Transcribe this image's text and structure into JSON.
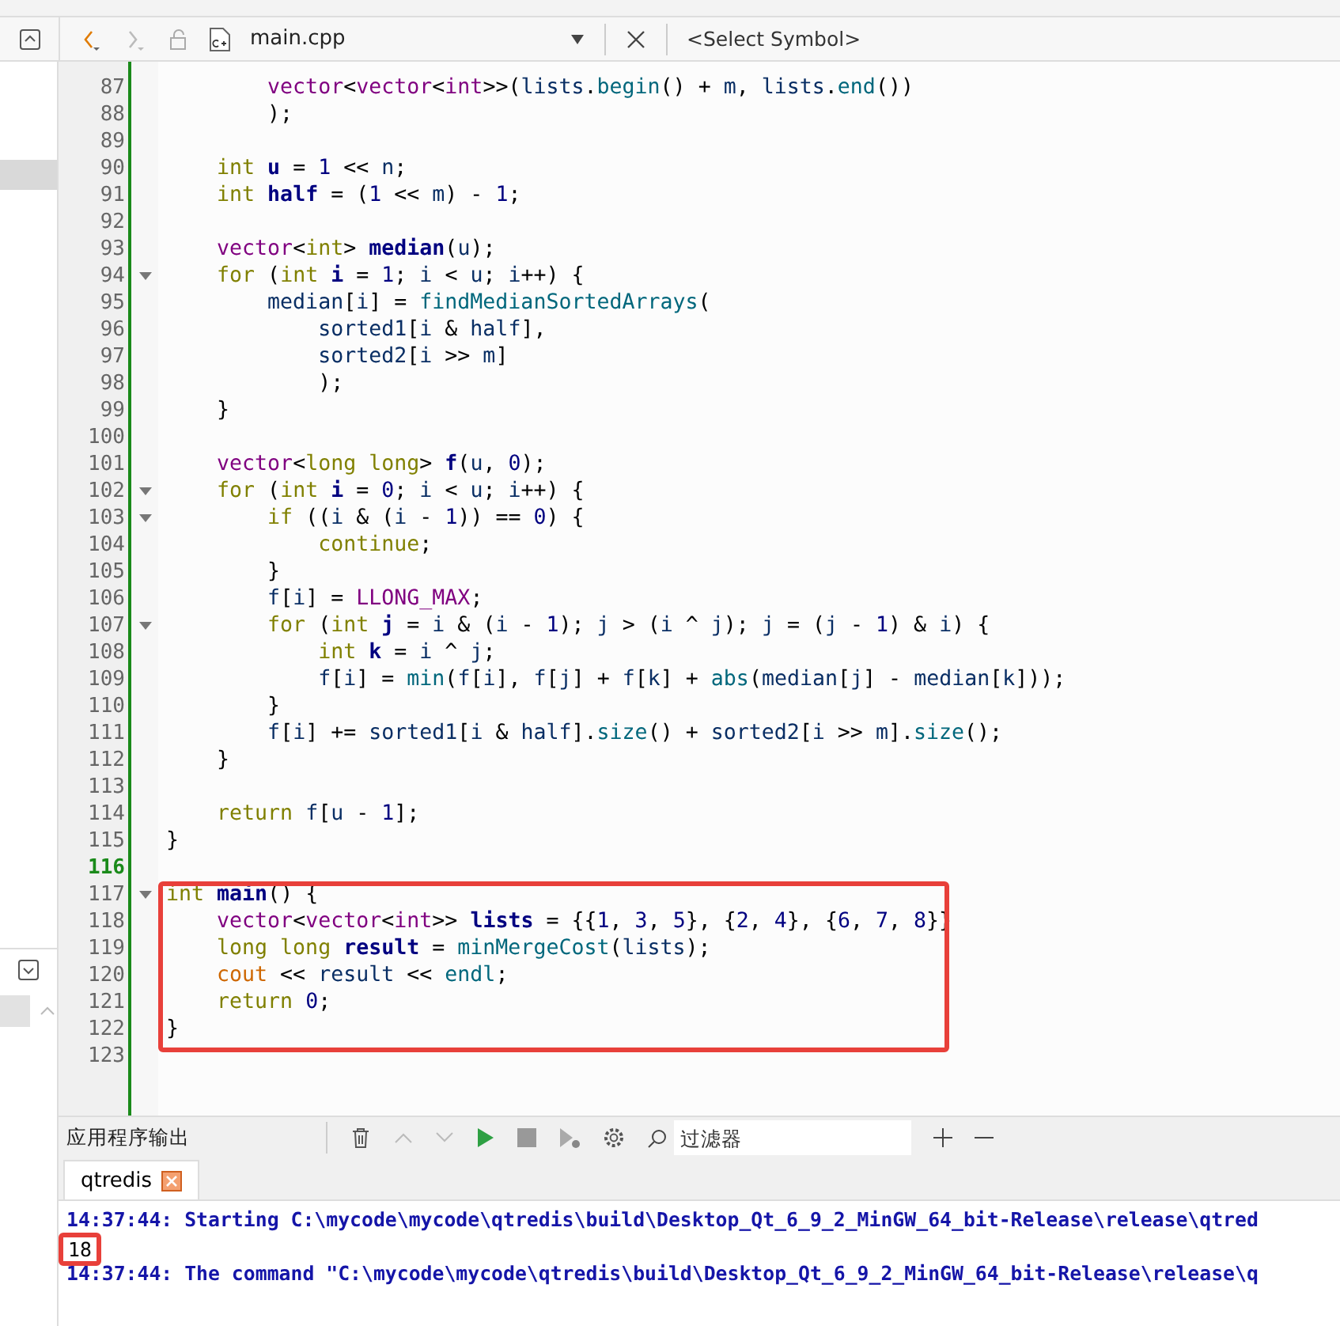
{
  "toolbar": {
    "file_name": "main.cpp",
    "symbol_placeholder": "<Select Symbol>",
    "back_enabled": true,
    "forward_enabled": false
  },
  "editor": {
    "blocks": [
      {
        "framed": false,
        "lines": [
          {
            "number": "87",
            "fold": false,
            "current": false,
            "tokens": [
              {
                "text": "        vector",
                "kind": "type"
              },
              {
                "text": "<",
                "kind": "plain"
              },
              {
                "text": "vector",
                "kind": "type"
              },
              {
                "text": "<",
                "kind": "plain"
              },
              {
                "text": "int",
                "kind": "type"
              },
              {
                "text": ">>(",
                "kind": "plain"
              },
              {
                "text": "lists",
                "kind": "var"
              },
              {
                "text": ".",
                "kind": "plain"
              },
              {
                "text": "begin",
                "kind": "func"
              },
              {
                "text": "() + ",
                "kind": "plain"
              },
              {
                "text": "m",
                "kind": "var"
              },
              {
                "text": ", ",
                "kind": "plain"
              },
              {
                "text": "lists",
                "kind": "var"
              },
              {
                "text": ".",
                "kind": "plain"
              },
              {
                "text": "end",
                "kind": "func"
              },
              {
                "text": "())",
                "kind": "plain"
              }
            ]
          },
          {
            "number": "88",
            "fold": false,
            "current": false,
            "tokens": [
              {
                "text": "        );",
                "kind": "plain"
              }
            ]
          },
          {
            "number": "89",
            "fold": false,
            "current": false
          },
          {
            "number": "90",
            "fold": false,
            "current": false,
            "tokens": [
              {
                "text": "    int",
                "kind": "keyword"
              },
              {
                "text": " u",
                "kind": "decl"
              },
              {
                "text": " = ",
                "kind": "plain"
              },
              {
                "text": "1",
                "kind": "number"
              },
              {
                "text": " << ",
                "kind": "plain"
              },
              {
                "text": "n",
                "kind": "var"
              },
              {
                "text": ";",
                "kind": "plain"
              }
            ]
          },
          {
            "number": "91",
            "fold": false,
            "current": false,
            "tokens": [
              {
                "text": "    int",
                "kind": "keyword"
              },
              {
                "text": " half",
                "kind": "decl"
              },
              {
                "text": " = (",
                "kind": "plain"
              },
              {
                "text": "1",
                "kind": "number"
              },
              {
                "text": " << ",
                "kind": "plain"
              },
              {
                "text": "m",
                "kind": "var"
              },
              {
                "text": ") - ",
                "kind": "plain"
              },
              {
                "text": "1",
                "kind": "number"
              },
              {
                "text": ";",
                "kind": "plain"
              }
            ]
          },
          {
            "number": "92",
            "fold": false,
            "current": false
          },
          {
            "number": "93",
            "fold": false,
            "current": false,
            "tokens": [
              {
                "text": "    vector",
                "kind": "type"
              },
              {
                "text": "<",
                "kind": "plain"
              },
              {
                "text": "int",
                "kind": "keyword"
              },
              {
                "text": "> ",
                "kind": "plain"
              },
              {
                "text": "median",
                "kind": "decl"
              },
              {
                "text": "(",
                "kind": "plain"
              },
              {
                "text": "u",
                "kind": "var"
              },
              {
                "text": ");",
                "kind": "plain"
              }
            ]
          },
          {
            "number": "94",
            "fold": true,
            "current": false,
            "tokens": [
              {
                "text": "    for",
                "kind": "keyword"
              },
              {
                "text": " (",
                "kind": "plain"
              },
              {
                "text": "int",
                "kind": "keyword"
              },
              {
                "text": " i",
                "kind": "decl"
              },
              {
                "text": " = ",
                "kind": "plain"
              },
              {
                "text": "1",
                "kind": "number"
              },
              {
                "text": "; ",
                "kind": "plain"
              },
              {
                "text": "i",
                "kind": "var"
              },
              {
                "text": " < ",
                "kind": "plain"
              },
              {
                "text": "u",
                "kind": "var"
              },
              {
                "text": "; ",
                "kind": "plain"
              },
              {
                "text": "i",
                "kind": "var"
              },
              {
                "text": "++) {",
                "kind": "plain"
              }
            ]
          },
          {
            "number": "95",
            "fold": false,
            "current": false,
            "tokens": [
              {
                "text": "        median",
                "kind": "var"
              },
              {
                "text": "[",
                "kind": "plain"
              },
              {
                "text": "i",
                "kind": "var"
              },
              {
                "text": "] = ",
                "kind": "plain"
              },
              {
                "text": "findMedianSortedArrays",
                "kind": "func"
              },
              {
                "text": "(",
                "kind": "plain"
              }
            ]
          },
          {
            "number": "96",
            "fold": false,
            "current": false,
            "tokens": [
              {
                "text": "            sorted1",
                "kind": "var"
              },
              {
                "text": "[",
                "kind": "plain"
              },
              {
                "text": "i",
                "kind": "var"
              },
              {
                "text": " & ",
                "kind": "plain"
              },
              {
                "text": "half",
                "kind": "var"
              },
              {
                "text": "],",
                "kind": "plain"
              }
            ]
          },
          {
            "number": "97",
            "fold": false,
            "current": false,
            "tokens": [
              {
                "text": "            sorted2",
                "kind": "var"
              },
              {
                "text": "[",
                "kind": "plain"
              },
              {
                "text": "i",
                "kind": "var"
              },
              {
                "text": " >> ",
                "kind": "plain"
              },
              {
                "text": "m",
                "kind": "var"
              },
              {
                "text": "]",
                "kind": "plain"
              }
            ]
          },
          {
            "number": "98",
            "fold": false,
            "current": false,
            "tokens": [
              {
                "text": "            );",
                "kind": "plain"
              }
            ]
          },
          {
            "number": "99",
            "fold": false,
            "current": false,
            "tokens": [
              {
                "text": "    }",
                "kind": "plain"
              }
            ]
          },
          {
            "number": "100",
            "fold": false,
            "current": false
          },
          {
            "number": "101",
            "fold": false,
            "current": false,
            "tokens": [
              {
                "text": "    vector",
                "kind": "type"
              },
              {
                "text": "<",
                "kind": "plain"
              },
              {
                "text": "long long",
                "kind": "keyword"
              },
              {
                "text": "> ",
                "kind": "plain"
              },
              {
                "text": "f",
                "kind": "decl"
              },
              {
                "text": "(",
                "kind": "plain"
              },
              {
                "text": "u",
                "kind": "var"
              },
              {
                "text": ", ",
                "kind": "plain"
              },
              {
                "text": "0",
                "kind": "number"
              },
              {
                "text": ");",
                "kind": "plain"
              }
            ]
          },
          {
            "number": "102",
            "fold": true,
            "current": false,
            "tokens": [
              {
                "text": "    for",
                "kind": "keyword"
              },
              {
                "text": " (",
                "kind": "plain"
              },
              {
                "text": "int",
                "kind": "keyword"
              },
              {
                "text": " i",
                "kind": "decl"
              },
              {
                "text": " = ",
                "kind": "plain"
              },
              {
                "text": "0",
                "kind": "number"
              },
              {
                "text": "; ",
                "kind": "plain"
              },
              {
                "text": "i",
                "kind": "var"
              },
              {
                "text": " < ",
                "kind": "plain"
              },
              {
                "text": "u",
                "kind": "var"
              },
              {
                "text": "; ",
                "kind": "plain"
              },
              {
                "text": "i",
                "kind": "var"
              },
              {
                "text": "++) {",
                "kind": "plain"
              }
            ]
          },
          {
            "number": "103",
            "fold": true,
            "current": false,
            "tokens": [
              {
                "text": "        if",
                "kind": "keyword"
              },
              {
                "text": " ((",
                "kind": "plain"
              },
              {
                "text": "i",
                "kind": "var"
              },
              {
                "text": " & (",
                "kind": "plain"
              },
              {
                "text": "i",
                "kind": "var"
              },
              {
                "text": " - ",
                "kind": "plain"
              },
              {
                "text": "1",
                "kind": "number"
              },
              {
                "text": ")) == ",
                "kind": "plain"
              },
              {
                "text": "0",
                "kind": "number"
              },
              {
                "text": ") {",
                "kind": "plain"
              }
            ]
          },
          {
            "number": "104",
            "fold": false,
            "current": false,
            "tokens": [
              {
                "text": "            continue",
                "kind": "keyword"
              },
              {
                "text": ";",
                "kind": "plain"
              }
            ]
          },
          {
            "number": "105",
            "fold": false,
            "current": false,
            "tokens": [
              {
                "text": "        }",
                "kind": "plain"
              }
            ]
          },
          {
            "number": "106",
            "fold": false,
            "current": false,
            "tokens": [
              {
                "text": "        f",
                "kind": "var"
              },
              {
                "text": "[",
                "kind": "plain"
              },
              {
                "text": "i",
                "kind": "var"
              },
              {
                "text": "] = ",
                "kind": "plain"
              },
              {
                "text": "LLONG_MAX",
                "kind": "macro"
              },
              {
                "text": ";",
                "kind": "plain"
              }
            ]
          },
          {
            "number": "107",
            "fold": true,
            "current": false,
            "tokens": [
              {
                "text": "        for",
                "kind": "keyword"
              },
              {
                "text": " (",
                "kind": "plain"
              },
              {
                "text": "int",
                "kind": "keyword"
              },
              {
                "text": " j",
                "kind": "decl"
              },
              {
                "text": " = ",
                "kind": "plain"
              },
              {
                "text": "i",
                "kind": "var"
              },
              {
                "text": " & (",
                "kind": "plain"
              },
              {
                "text": "i",
                "kind": "var"
              },
              {
                "text": " - ",
                "kind": "plain"
              },
              {
                "text": "1",
                "kind": "number"
              },
              {
                "text": "); ",
                "kind": "plain"
              },
              {
                "text": "j",
                "kind": "var"
              },
              {
                "text": " > (",
                "kind": "plain"
              },
              {
                "text": "i",
                "kind": "var"
              },
              {
                "text": " ^ ",
                "kind": "plain"
              },
              {
                "text": "j",
                "kind": "var"
              },
              {
                "text": "); ",
                "kind": "plain"
              },
              {
                "text": "j",
                "kind": "var"
              },
              {
                "text": " = (",
                "kind": "plain"
              },
              {
                "text": "j",
                "kind": "var"
              },
              {
                "text": " - ",
                "kind": "plain"
              },
              {
                "text": "1",
                "kind": "number"
              },
              {
                "text": ") & ",
                "kind": "plain"
              },
              {
                "text": "i",
                "kind": "var"
              },
              {
                "text": ") {",
                "kind": "plain"
              }
            ]
          },
          {
            "number": "108",
            "fold": false,
            "current": false,
            "tokens": [
              {
                "text": "            int",
                "kind": "keyword"
              },
              {
                "text": " k",
                "kind": "decl"
              },
              {
                "text": " = ",
                "kind": "plain"
              },
              {
                "text": "i",
                "kind": "var"
              },
              {
                "text": " ^ ",
                "kind": "plain"
              },
              {
                "text": "j",
                "kind": "var"
              },
              {
                "text": ";",
                "kind": "plain"
              }
            ]
          },
          {
            "number": "109",
            "fold": false,
            "current": false,
            "tokens": [
              {
                "text": "            f",
                "kind": "var"
              },
              {
                "text": "[",
                "kind": "plain"
              },
              {
                "text": "i",
                "kind": "var"
              },
              {
                "text": "] = ",
                "kind": "plain"
              },
              {
                "text": "min",
                "kind": "func"
              },
              {
                "text": "(",
                "kind": "plain"
              },
              {
                "text": "f",
                "kind": "var"
              },
              {
                "text": "[",
                "kind": "plain"
              },
              {
                "text": "i",
                "kind": "var"
              },
              {
                "text": "], ",
                "kind": "plain"
              },
              {
                "text": "f",
                "kind": "var"
              },
              {
                "text": "[",
                "kind": "plain"
              },
              {
                "text": "j",
                "kind": "var"
              },
              {
                "text": "] + ",
                "kind": "plain"
              },
              {
                "text": "f",
                "kind": "var"
              },
              {
                "text": "[",
                "kind": "plain"
              },
              {
                "text": "k",
                "kind": "var"
              },
              {
                "text": "] + ",
                "kind": "plain"
              },
              {
                "text": "abs",
                "kind": "func"
              },
              {
                "text": "(",
                "kind": "plain"
              },
              {
                "text": "median",
                "kind": "var"
              },
              {
                "text": "[",
                "kind": "plain"
              },
              {
                "text": "j",
                "kind": "var"
              },
              {
                "text": "] - ",
                "kind": "plain"
              },
              {
                "text": "median",
                "kind": "var"
              },
              {
                "text": "[",
                "kind": "plain"
              },
              {
                "text": "k",
                "kind": "var"
              },
              {
                "text": "]));",
                "kind": "plain"
              }
            ]
          },
          {
            "number": "110",
            "fold": false,
            "current": false,
            "tokens": [
              {
                "text": "        }",
                "kind": "plain"
              }
            ]
          },
          {
            "number": "111",
            "fold": false,
            "current": false,
            "tokens": [
              {
                "text": "        f",
                "kind": "var"
              },
              {
                "text": "[",
                "kind": "plain"
              },
              {
                "text": "i",
                "kind": "var"
              },
              {
                "text": "] += ",
                "kind": "plain"
              },
              {
                "text": "sorted1",
                "kind": "var"
              },
              {
                "text": "[",
                "kind": "plain"
              },
              {
                "text": "i",
                "kind": "var"
              },
              {
                "text": " & ",
                "kind": "plain"
              },
              {
                "text": "half",
                "kind": "var"
              },
              {
                "text": "].",
                "kind": "plain"
              },
              {
                "text": "size",
                "kind": "func"
              },
              {
                "text": "() + ",
                "kind": "plain"
              },
              {
                "text": "sorted2",
                "kind": "var"
              },
              {
                "text": "[",
                "kind": "plain"
              },
              {
                "text": "i",
                "kind": "var"
              },
              {
                "text": " >> ",
                "kind": "plain"
              },
              {
                "text": "m",
                "kind": "var"
              },
              {
                "text": "].",
                "kind": "plain"
              },
              {
                "text": "size",
                "kind": "func"
              },
              {
                "text": "();",
                "kind": "plain"
              }
            ]
          },
          {
            "number": "112",
            "fold": false,
            "current": false,
            "tokens": [
              {
                "text": "    }",
                "kind": "plain"
              }
            ]
          },
          {
            "number": "113",
            "fold": false,
            "current": false
          },
          {
            "number": "114",
            "fold": false,
            "current": false,
            "tokens": [
              {
                "text": "    return",
                "kind": "keyword"
              },
              {
                "text": " f",
                "kind": "var"
              },
              {
                "text": "[",
                "kind": "plain"
              },
              {
                "text": "u",
                "kind": "var"
              },
              {
                "text": " - ",
                "kind": "plain"
              },
              {
                "text": "1",
                "kind": "number"
              },
              {
                "text": "];",
                "kind": "plain"
              }
            ]
          },
          {
            "number": "115",
            "fold": false,
            "current": false,
            "tokens": [
              {
                "text": "}",
                "kind": "plain"
              }
            ]
          },
          {
            "number": "116",
            "fold": false,
            "current": true
          }
        ]
      },
      {
        "framed": true,
        "lines": [
          {
            "number": "117",
            "fold": true,
            "current": false,
            "tokens": [
              {
                "text": "int",
                "kind": "keyword"
              },
              {
                "text": " main",
                "kind": "decl"
              },
              {
                "text": "() {",
                "kind": "plain"
              }
            ]
          },
          {
            "number": "118",
            "fold": false,
            "current": false,
            "tokens": [
              {
                "text": "    vector",
                "kind": "type"
              },
              {
                "text": "<",
                "kind": "plain"
              },
              {
                "text": "vector",
                "kind": "type"
              },
              {
                "text": "<",
                "kind": "plain"
              },
              {
                "text": "int",
                "kind": "type"
              },
              {
                "text": ">> ",
                "kind": "plain"
              },
              {
                "text": "lists",
                "kind": "decl"
              },
              {
                "text": " = {{",
                "kind": "plain"
              },
              {
                "text": "1",
                "kind": "number"
              },
              {
                "text": ", ",
                "kind": "plain"
              },
              {
                "text": "3",
                "kind": "number"
              },
              {
                "text": ", ",
                "kind": "plain"
              },
              {
                "text": "5",
                "kind": "number"
              },
              {
                "text": "}, {",
                "kind": "plain"
              },
              {
                "text": "2",
                "kind": "number"
              },
              {
                "text": ", ",
                "kind": "plain"
              },
              {
                "text": "4",
                "kind": "number"
              },
              {
                "text": "}, {",
                "kind": "plain"
              },
              {
                "text": "6",
                "kind": "number"
              },
              {
                "text": ", ",
                "kind": "plain"
              },
              {
                "text": "7",
                "kind": "number"
              },
              {
                "text": ", ",
                "kind": "plain"
              },
              {
                "text": "8",
                "kind": "number"
              },
              {
                "text": "}}",
                "kind": "plain"
              }
            ]
          },
          {
            "number": "119",
            "fold": false,
            "current": false,
            "tokens": [
              {
                "text": "    long long",
                "kind": "keyword"
              },
              {
                "text": " result",
                "kind": "decl"
              },
              {
                "text": " = ",
                "kind": "plain"
              },
              {
                "text": "minMergeCost",
                "kind": "func"
              },
              {
                "text": "(",
                "kind": "plain"
              },
              {
                "text": "lists",
                "kind": "var"
              },
              {
                "text": ");",
                "kind": "plain"
              }
            ]
          },
          {
            "number": "120",
            "fold": false,
            "current": false,
            "tokens": [
              {
                "text": "    cout",
                "kind": "stream"
              },
              {
                "text": " << ",
                "kind": "plain"
              },
              {
                "text": "result",
                "kind": "var"
              },
              {
                "text": " << ",
                "kind": "plain"
              },
              {
                "text": "endl",
                "kind": "func"
              },
              {
                "text": ";",
                "kind": "plain"
              }
            ]
          },
          {
            "number": "121",
            "fold": false,
            "current": false,
            "tokens": [
              {
                "text": "    return",
                "kind": "keyword"
              },
              {
                "text": " 0",
                "kind": "number"
              },
              {
                "text": ";",
                "kind": "plain"
              }
            ]
          },
          {
            "number": "122",
            "fold": false,
            "current": false,
            "tokens": [
              {
                "text": "}",
                "kind": "plain"
              }
            ]
          }
        ]
      },
      {
        "framed": false,
        "lines": [
          {
            "number": "123",
            "fold": false,
            "current": false
          }
        ]
      }
    ]
  },
  "output": {
    "title": "应用程序输出",
    "filter_placeholder": "过滤器",
    "tabs": [
      {
        "label": "qtredis",
        "selected": true
      }
    ],
    "lines": [
      {
        "text": "14:37:44: Starting C:\\mycode\\mycode\\qtredis\\build\\Desktop_Qt_6_9_2_MinGW_64_bit-Release\\release\\qtred",
        "kind": "message",
        "framed": false
      },
      {
        "text": "18",
        "kind": "program",
        "framed": true
      },
      {
        "text": "14:37:44: The command \"C:\\mycode\\mycode\\qtredis\\build\\Desktop_Qt_6_9_2_MinGW_64_bit-Release\\release\\q",
        "kind": "message",
        "framed": false
      }
    ]
  }
}
